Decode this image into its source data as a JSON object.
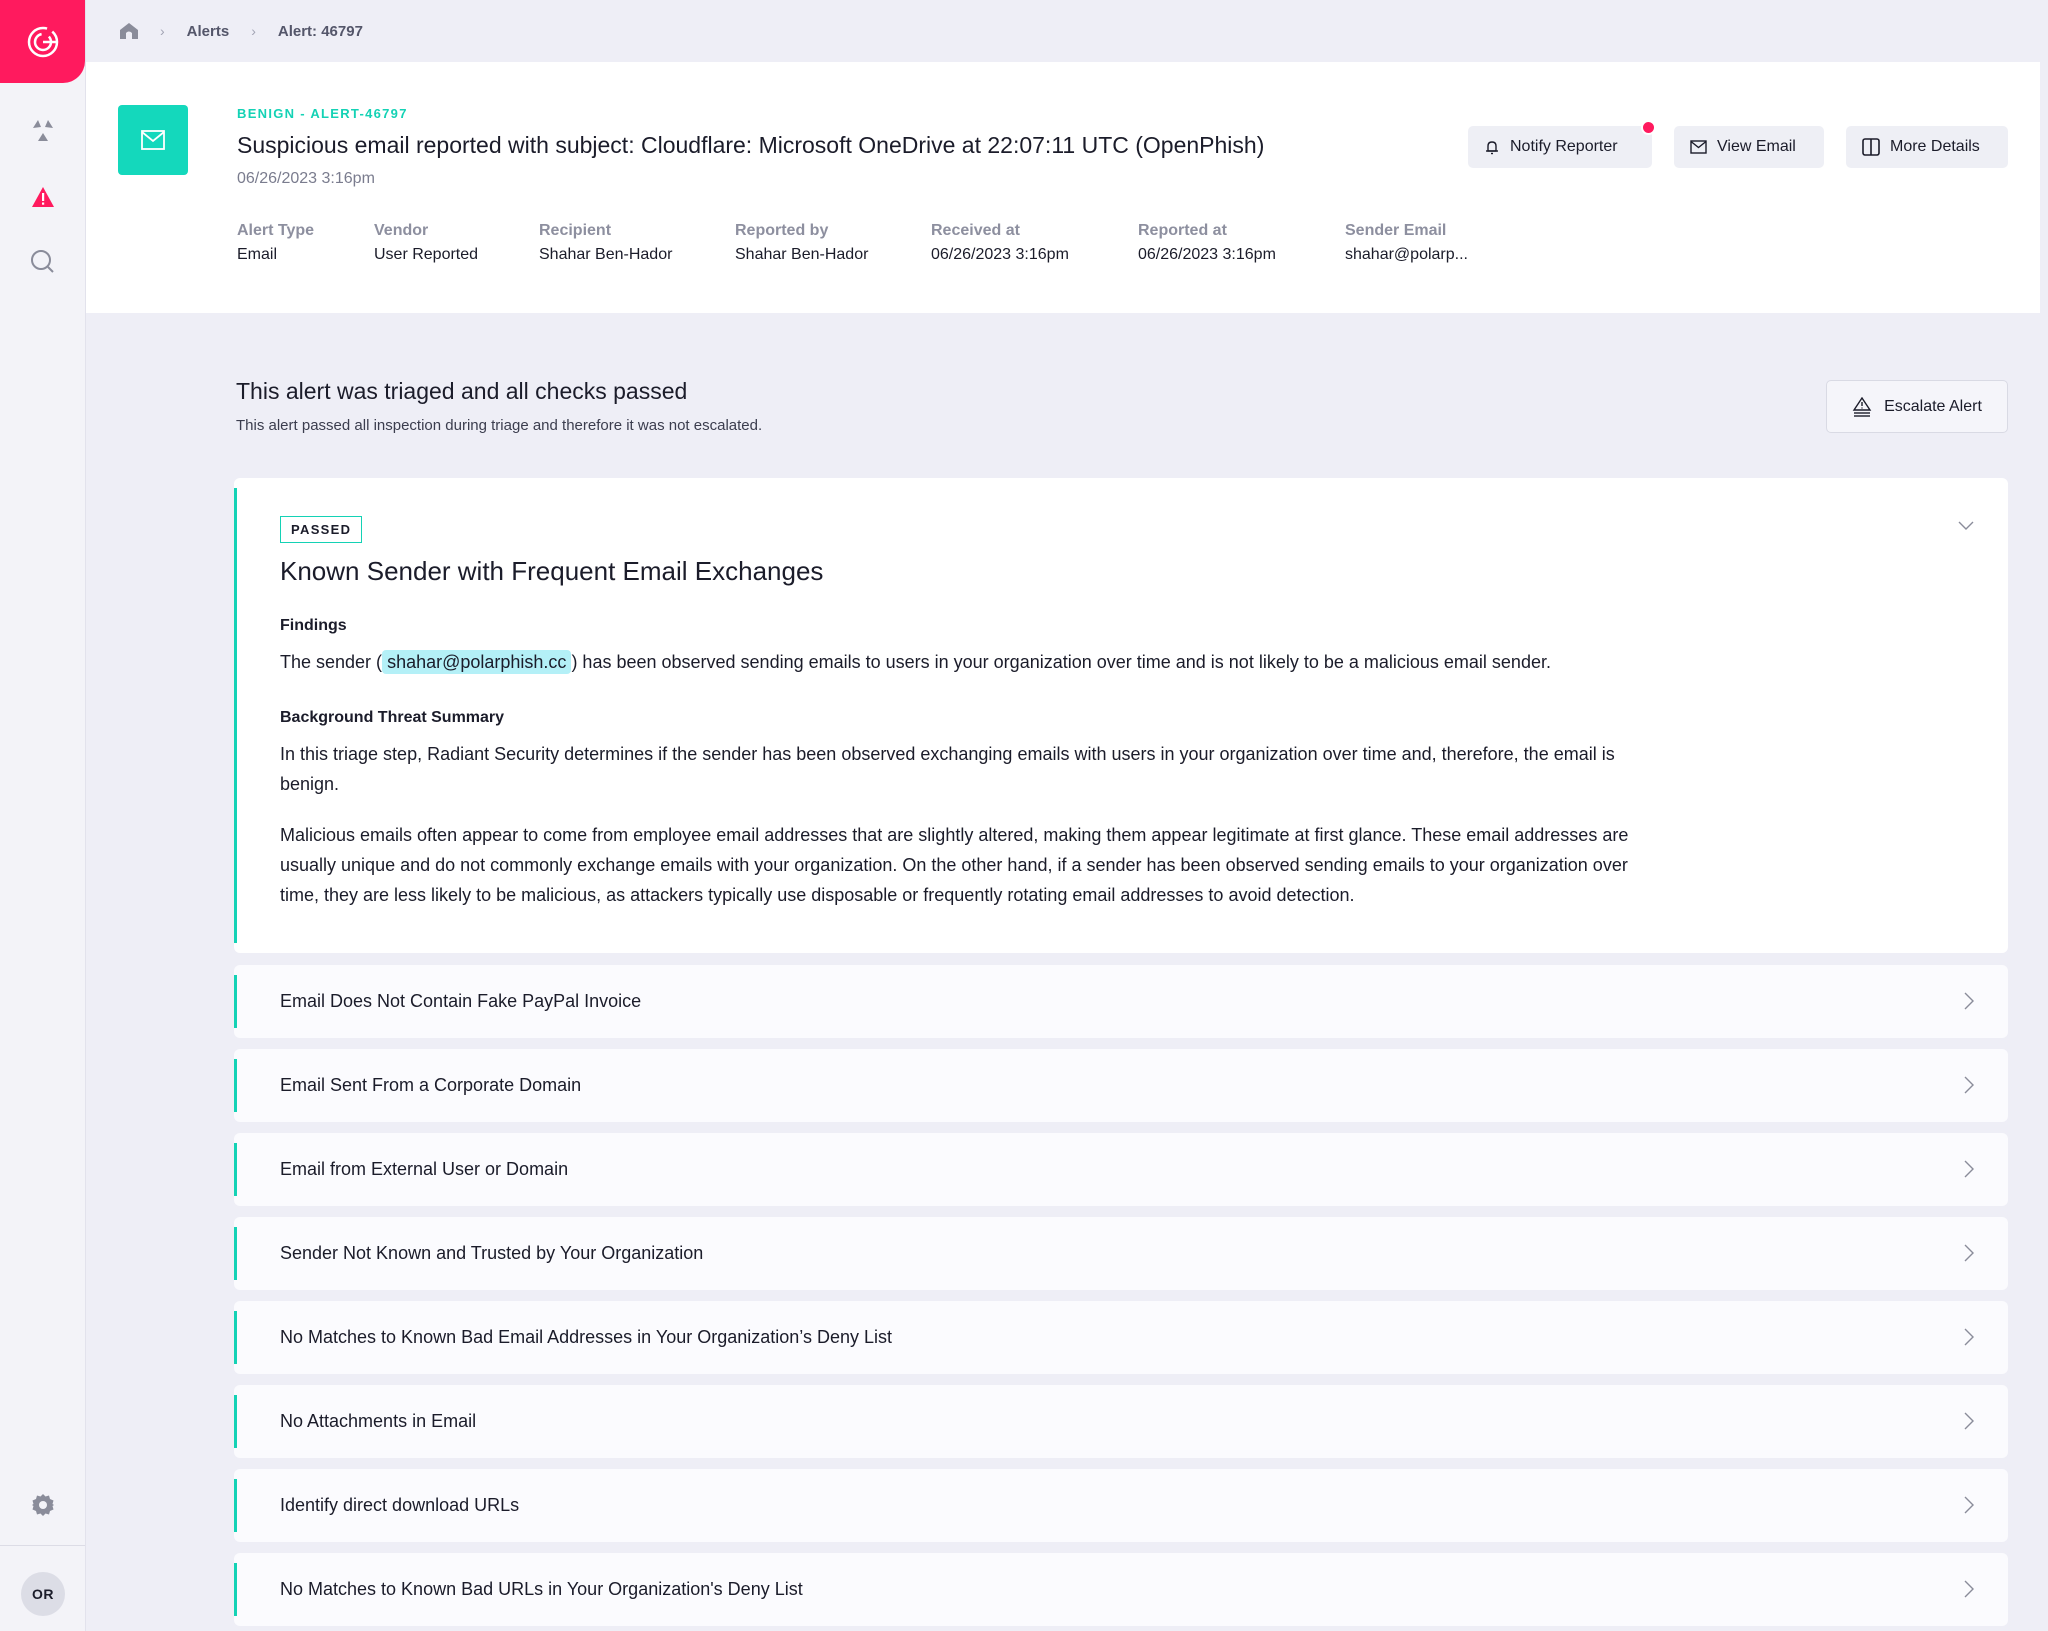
{
  "sidebar": {
    "logo": "radiant-logo",
    "items": [
      {
        "name": "radiation-icon",
        "label": "Threats"
      },
      {
        "name": "alert-triangle-icon",
        "label": "Alerts",
        "active": true
      },
      {
        "name": "search-icon",
        "label": "Search"
      }
    ],
    "settings_icon": "gear-icon",
    "avatar_initials": "OR"
  },
  "breadcrumb": {
    "home_icon": "home-icon",
    "items": [
      "Alerts",
      "Alert: 46797"
    ]
  },
  "header": {
    "status_line": "BENIGN - ALERT-46797",
    "title": "Suspicious email reported with subject: Cloudflare: Microsoft OneDrive at 22:07:11 UTC (OpenPhish)",
    "date": "06/26/2023 3:16pm",
    "meta": [
      {
        "label": "Alert Type",
        "value": "Email"
      },
      {
        "label": "Vendor",
        "value": "User Reported"
      },
      {
        "label": "Recipient",
        "value": "Shahar Ben-Hador"
      },
      {
        "label": "Reported by",
        "value": "Shahar Ben-Hador"
      },
      {
        "label": "Received at",
        "value": "06/26/2023 3:16pm"
      },
      {
        "label": "Reported at",
        "value": "06/26/2023 3:16pm"
      },
      {
        "label": "Sender Email",
        "value": "shahar@polarp..."
      }
    ],
    "actions": {
      "notify": "Notify Reporter",
      "view_email": "View Email",
      "more_details": "More Details"
    }
  },
  "triage": {
    "title": "This alert was triaged and all checks passed",
    "subtitle": "This alert passed all inspection during triage and therefore it was not escalated.",
    "escalate_label": "Escalate Alert"
  },
  "expanded_check": {
    "badge": "PASSED",
    "title": "Known Sender with Frequent Email Exchanges",
    "findings_label": "Findings",
    "findings_prefix": "The sender (",
    "findings_email": "shahar@polarphish.cc",
    "findings_suffix": ") has been observed sending emails to users in your organization over time and is not likely to be a malicious email sender.",
    "background_label": "Background Threat Summary",
    "background_p1": "In this triage step, Radiant Security determines if the sender has been observed exchanging emails with users in your organization over time and, therefore, the email is benign.",
    "background_p2": "Malicious emails often appear to come from employee email addresses that are slightly altered, making them appear legitimate at first glance. These email addresses are usually unique and do not commonly exchange emails with your organization. On the other hand, if a sender has been observed sending emails to your organization over time, they are less likely to be malicious, as attackers typically use disposable or frequently rotating email addresses to avoid detection."
  },
  "checks": [
    "Email Does Not Contain Fake PayPal Invoice",
    "Email Sent From a Corporate Domain",
    "Email from External User or Domain",
    "Sender Not Known and Trusted by Your Organization",
    "No Matches to Known Bad Email Addresses in Your Organization’s Deny List",
    "No Attachments in Email",
    "Identify direct download URLs",
    "No Matches to Known Bad URLs in Your Organization's Deny List"
  ],
  "colors": {
    "brand": "#ff1a5e",
    "accent": "#14d2b5",
    "email_chip": "#b4f0f7"
  }
}
